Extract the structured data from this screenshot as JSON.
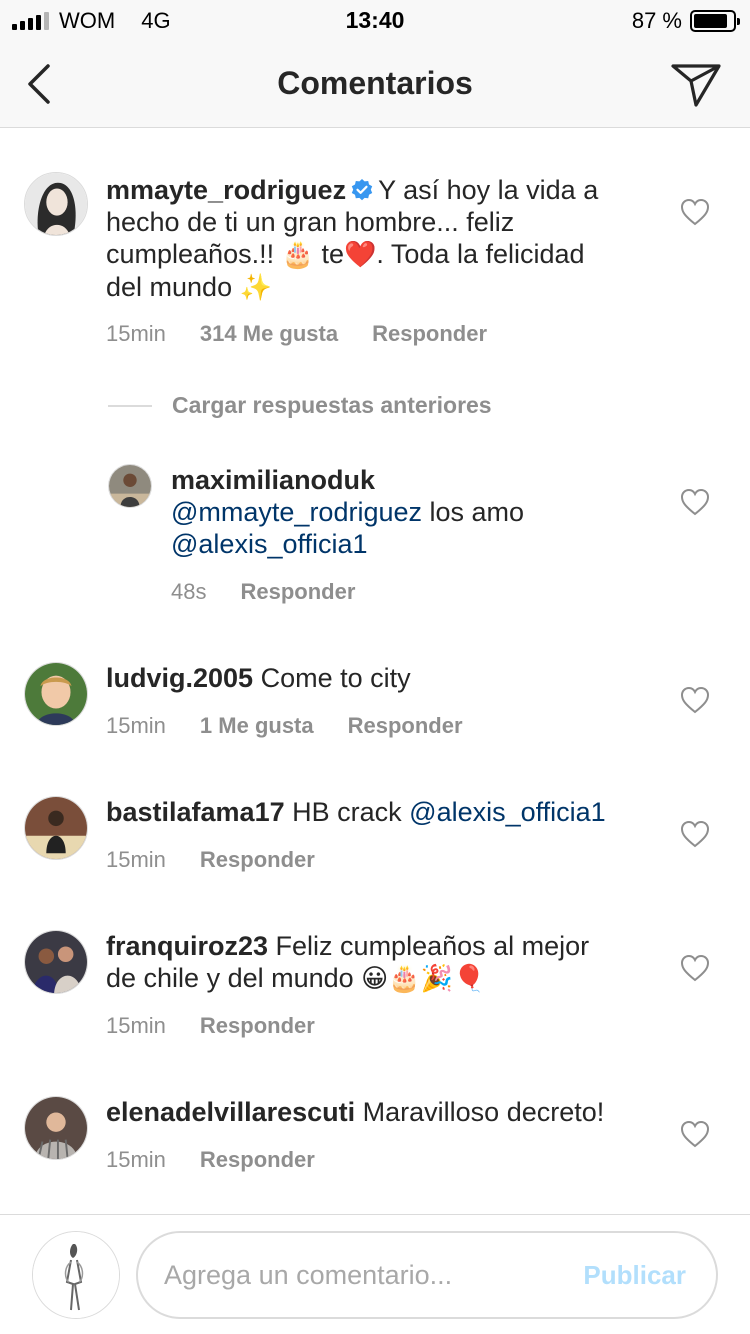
{
  "status_bar": {
    "carrier": "WOM",
    "network": "4G",
    "time": "13:40",
    "battery_text": "87 %",
    "battery_level": 0.87
  },
  "nav": {
    "title": "Comentarios",
    "back_icon": "chevron-left-icon",
    "send_icon": "paper-plane-icon"
  },
  "comments": [
    {
      "username": "mmayte_rodriguez",
      "verified": true,
      "text_1": "Y así hoy la vida a",
      "text_2": "hecho de ti un gran hombre... feliz",
      "text_3a": "cumpleaños.!! ",
      "emoji_cake": "🎂",
      "text_3b": " te",
      "emoji_heart": "❤️",
      "text_3c": ". Toda la felicidad",
      "text_4": "del mundo ",
      "emoji_sparkles": "✨",
      "time": "15min",
      "likes": "314 Me gusta",
      "reply": "Responder"
    },
    {
      "username": "ludvig.2005",
      "text": "Come to city",
      "time": "15min",
      "likes": "1 Me gusta",
      "reply": "Responder"
    },
    {
      "username": "bastilafama17",
      "text": "HB crack",
      "mention": "@alexis_officia1",
      "time": "15min",
      "reply": "Responder"
    },
    {
      "username": "franquiroz23",
      "text_1": "Feliz cumpleaños al mejor",
      "text_2": "de chile y del mundo",
      "emojis": "😀🎂🎉🎈",
      "time": "15min",
      "reply": "Responder"
    },
    {
      "username": "elenadelvillarescuti",
      "text": "Maravilloso decreto!",
      "time": "15min",
      "reply": "Responder"
    }
  ],
  "load_previous": "Cargar respuestas anteriores",
  "reply": {
    "username": "maximilianoduk",
    "mention_1": "@mmayte_rodriguez",
    "text": " los amo",
    "mention_2": "@alexis_officia1",
    "time": "48s",
    "reply": "Responder"
  },
  "composer": {
    "placeholder": "Agrega un comentario...",
    "publish": "Publicar"
  },
  "colors": {
    "text": "#262626",
    "meta": "#8e8e8e",
    "mention": "#003569",
    "publish_disabled": "#b2dffc",
    "verified": "#3897f0",
    "border": "#dbdbdb"
  }
}
